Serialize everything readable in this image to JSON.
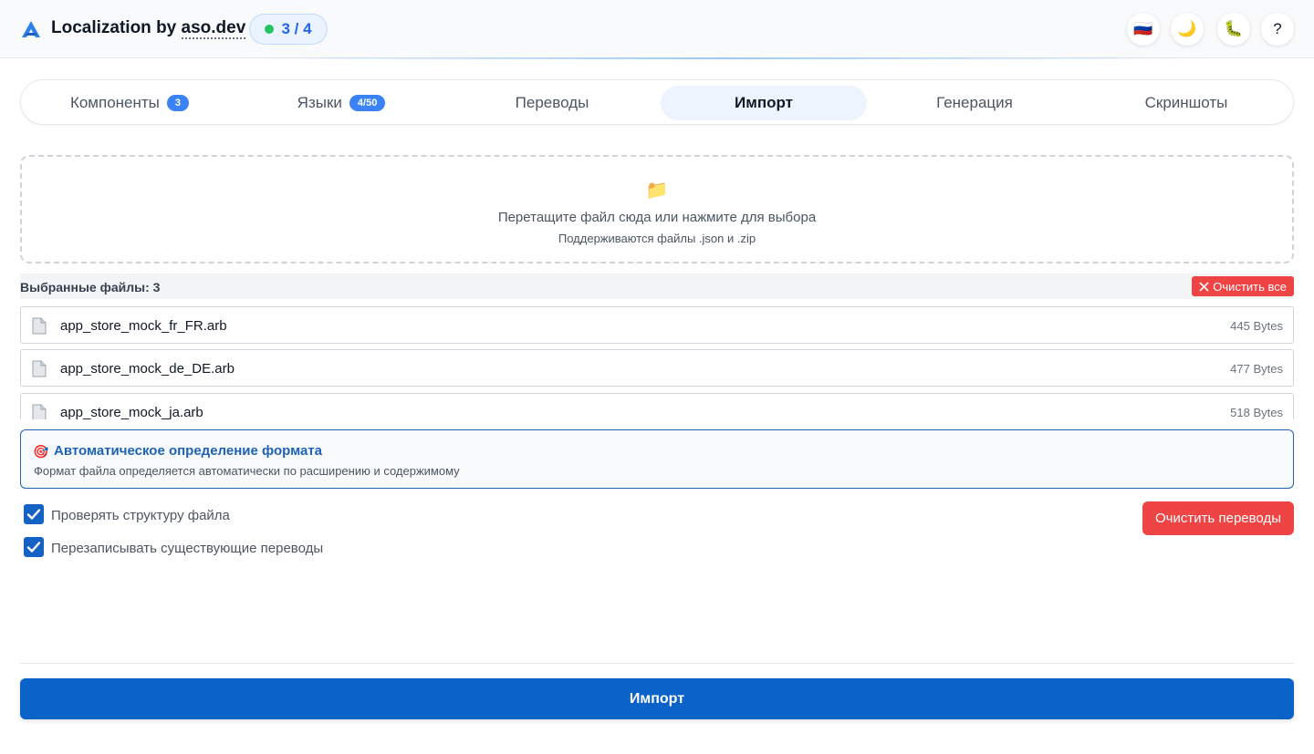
{
  "header": {
    "title_prefix": "Localization by ",
    "title_brand": "aso.dev",
    "progress": "3 / 4",
    "buttons": [
      {
        "name": "language-flag-button",
        "glyph": "🇷🇺"
      },
      {
        "name": "theme-toggle-button",
        "glyph": "🌙"
      },
      {
        "name": "bug-report-button",
        "glyph": "🐛"
      },
      {
        "name": "help-button",
        "glyph": "?"
      }
    ]
  },
  "tabs": [
    {
      "label": "Компоненты",
      "count": "3"
    },
    {
      "label": "Языки",
      "count": "4/50"
    },
    {
      "label": "Переводы",
      "count": null
    },
    {
      "label": "Импорт",
      "count": null
    },
    {
      "label": "Генерация",
      "count": null
    },
    {
      "label": "Скриншоты",
      "count": null
    }
  ],
  "active_tab": "Импорт",
  "dropzone": {
    "icon": "📁",
    "main_text": "Перетащите файл сюда или нажмите для выбора",
    "sub_text": "Поддерживаются файлы .json и .zip"
  },
  "selected_files": {
    "label": "Выбранные файлы: 3",
    "clear_all_label": "Очистить все",
    "files": [
      {
        "name": "app_store_mock_fr_FR.arb",
        "size": "445 Bytes"
      },
      {
        "name": "app_store_mock_de_DE.arb",
        "size": "477 Bytes"
      },
      {
        "name": "app_store_mock_ja.arb",
        "size": "518 Bytes"
      }
    ]
  },
  "autodetect": {
    "icon": "🎯",
    "title": "Автоматическое определение формата",
    "description": "Формат файла определяется автоматически по расширению и содержимому"
  },
  "options": {
    "validate_structure": {
      "label": "Проверять структуру файла",
      "checked": true
    },
    "overwrite_existing": {
      "label": "Перезаписывать существующие переводы",
      "checked": true
    },
    "clear_translations_label": "Очистить переводы"
  },
  "import_button_label": "Импорт",
  "colors": {
    "accent": "#0b63c9",
    "badge_blue": "#3b82f6",
    "danger": "#ef4444",
    "success_dot": "#22c55e"
  }
}
